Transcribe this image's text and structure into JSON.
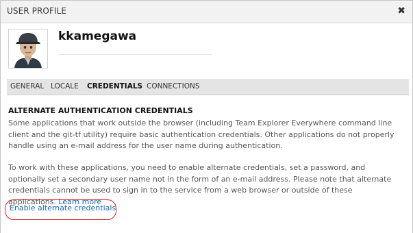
{
  "dialog": {
    "title": "USER PROFILE",
    "close_icon": "close-icon",
    "username": "kkamegawa"
  },
  "tabs": [
    {
      "label": "GENERAL",
      "active": false
    },
    {
      "label": "LOCALE",
      "active": false
    },
    {
      "label": "CREDENTIALS",
      "active": true
    },
    {
      "label": "CONNECTIONS",
      "active": false
    }
  ],
  "content": {
    "section_title": "ALTERNATE AUTHENTICATION CREDENTIALS",
    "para1": "Some applications that work outside the browser (including Team Explorer Everywhere command line client and the git-tf utility) require basic authentication credentials. Other applications do not properly handle using an e-mail address for the user name during authentication.",
    "para2": "To work with these applications, you need to enable alternate credentials, set a password, and optionally set a secondary user name not in the form of an e-mail address. Please note that alternate credentials cannot be used to sign in to the service from a web browser or outside of these applications.",
    "learn_more": "Learn more",
    "enable_link": "Enable alternate credentials"
  },
  "colors": {
    "link": "#1a64b1",
    "highlight": "#d6212a",
    "tab_bar": "#e4e4e4",
    "title_bar": "#f2f2f2"
  }
}
